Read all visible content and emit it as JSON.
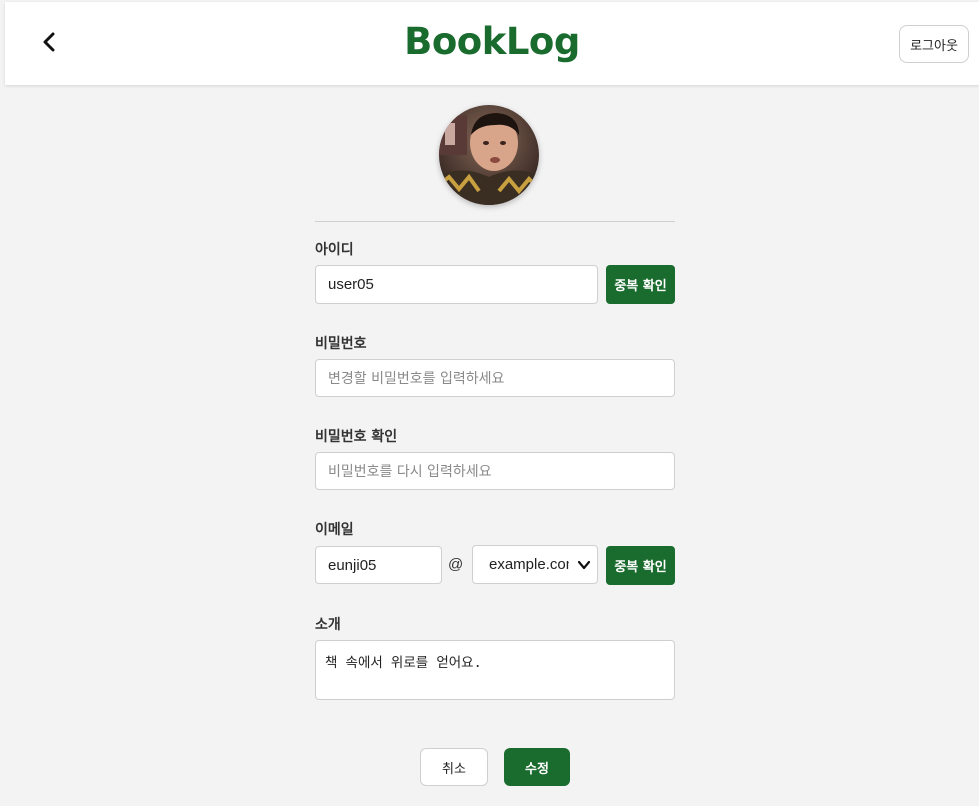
{
  "header": {
    "logo": "BookLog",
    "back_icon": "chevron-left-icon",
    "logout_label": "로그아웃"
  },
  "profile": {
    "avatar_icon": "user-photo"
  },
  "form": {
    "id_label": "아이디",
    "id_value": "user05",
    "id_check_label": "중복 확인",
    "password_label": "비밀번호",
    "password_placeholder": "변경할 비밀번호를 입력하세요",
    "password_confirm_label": "비밀번호 확인",
    "password_confirm_placeholder": "비밀번호를 다시 입력하세요",
    "email_label": "이메일",
    "email_local": "eunji05",
    "email_at": "@",
    "email_domain_selected": "example.com",
    "email_check_label": "중복 확인",
    "intro_label": "소개",
    "intro_value": "책 속에서 위로를 얻어요."
  },
  "actions": {
    "cancel_label": "취소",
    "submit_label": "수정"
  },
  "colors": {
    "brand": "#1a6b2e",
    "background": "#f3f3f3"
  }
}
